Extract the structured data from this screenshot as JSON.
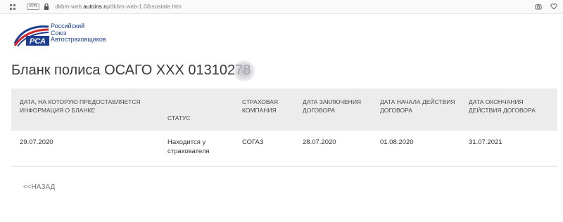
{
  "browser": {
    "vpn_label": "VPN",
    "url_prefix": "dkbm-web.",
    "url_domain": "autoins.ru",
    "url_path": "/dkbm-web-1.0/bsostate.htm"
  },
  "logo": {
    "line1": "Российский",
    "line2": "Союз",
    "line3": "Автостраховщиков",
    "mark_text": "РСА",
    "colors": {
      "blue": "#1d3d8f",
      "red": "#d0262e"
    }
  },
  "page": {
    "title": "Бланк полиса ОСАГО ХХХ 01310278"
  },
  "table": {
    "headers": [
      "ДАТА, НА КОТОРУЮ ПРЕДОСТАВЛЯЕТСЯ ИНФОРМАЦИЯ О БЛАНКЕ",
      "СТАТУС",
      "СТРАХОВАЯ КОМПАНИЯ",
      "ДАТА ЗАКЛЮЧЕНИЯ ДОГОВОРА",
      "ДАТА НАЧАЛА ДЕЙСТВИЯ ДОГОВОРА",
      "ДАТА ОКОНЧАНИЯ ДЕЙСТВИЯ ДОГОВОРА"
    ],
    "row": [
      "29.07.2020",
      "Находится у страхователя",
      "СОГАЗ",
      "28.07.2020",
      "01.08.2020",
      "31.07.2021"
    ]
  },
  "nav": {
    "back_label": "<<НАЗАД"
  }
}
